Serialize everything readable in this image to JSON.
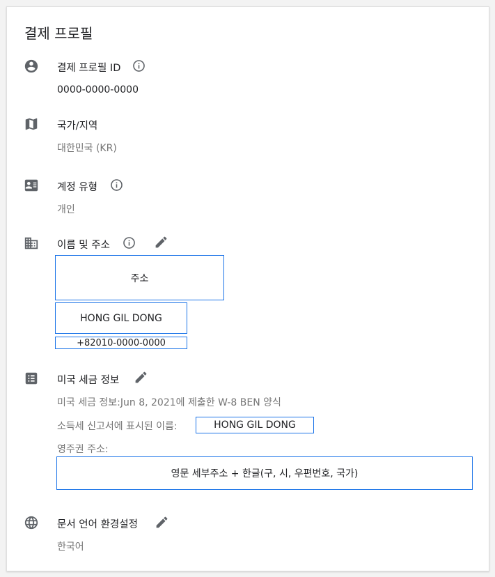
{
  "page_title": "결제 프로필",
  "sections": {
    "profile_id": {
      "label": "결제 프로필 ID",
      "value": "0000-0000-0000"
    },
    "country": {
      "label": "국가/지역",
      "value": "대한민국 (KR)"
    },
    "account_type": {
      "label": "계정 유형",
      "value": "개인"
    },
    "name_address": {
      "label": "이름 및 주소",
      "address_box": "주소",
      "name_box": "HONG GIL DONG",
      "phone_box": "+82010-0000-0000"
    },
    "us_tax": {
      "label": "미국 세금 정보",
      "info_line": "미국 세금 정보:Jun 8, 2021에 제출한 W-8 BEN 양식",
      "name_label": "소득세 신고서에 표시된 이름:",
      "name_value": "HONG GIL DONG",
      "address_label": "영주권 주소:",
      "address_value": "영문 세부주소 + 한글(구, 시, 우편번호, 국가)"
    },
    "doc_language": {
      "label": "문서 언어 환경설정",
      "value": "한국어"
    }
  },
  "icons": {
    "person": "account-circle-icon",
    "map": "map-icon",
    "id_card": "id-card-icon",
    "building": "building-icon",
    "list": "list-icon",
    "globe": "globe-icon",
    "info": "info-icon",
    "edit": "pencil-icon"
  },
  "colors": {
    "icon": "#5f6368",
    "border_highlight": "#1a73e8",
    "muted_text": "#757575"
  }
}
